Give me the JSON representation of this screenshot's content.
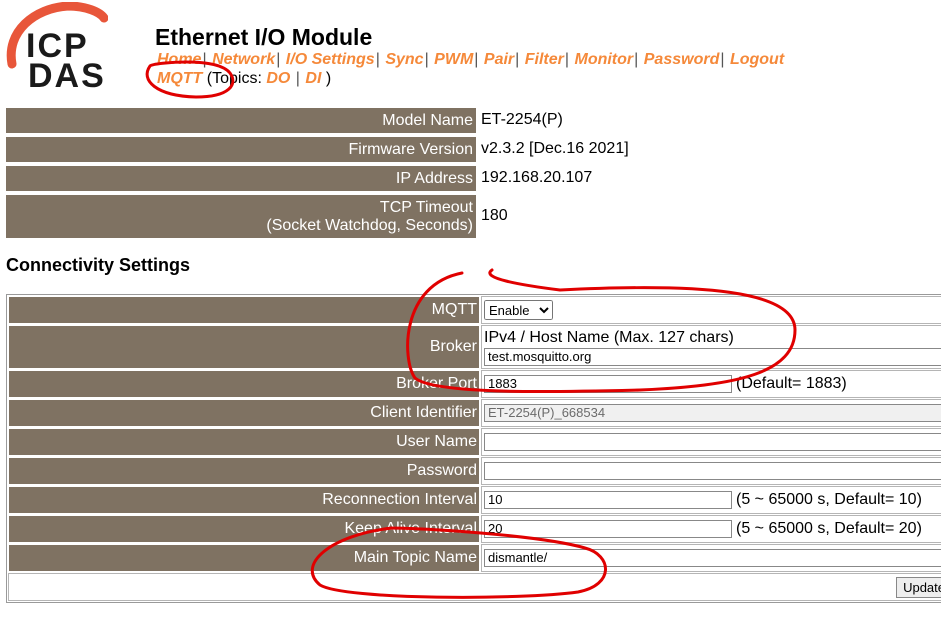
{
  "brand": {
    "logo_line1": "ICP",
    "logo_line2": "DAS",
    "accent": "#f5893a",
    "logo_arc": "#e8563a"
  },
  "header": {
    "title": "Ethernet I/O Module",
    "nav": [
      "Home",
      "Network",
      "I/O Settings",
      "Sync",
      "PWM",
      "Pair",
      "Filter",
      "Monitor",
      "Password",
      "Logout"
    ],
    "mqtt_link": "MQTT",
    "topics_prefix": "(Topics:",
    "topic_do": "DO",
    "topic_di": "DI",
    "topics_suffix": ")"
  },
  "info": {
    "model_label": "Model Name",
    "model_value": "ET-2254(P)",
    "fw_label": "Firmware Version",
    "fw_value": "v2.3.2 [Dec.16 2021]",
    "ip_label": "IP Address",
    "ip_value": "192.168.20.107",
    "tcp_label_1": "TCP Timeout",
    "tcp_label_2": "(Socket Watchdog, Seconds)",
    "tcp_value": "180"
  },
  "connectivity": {
    "section_title": "Connectivity Settings",
    "mqtt_label": "MQTT",
    "mqtt_value": "Enable",
    "broker_label": "Broker",
    "broker_hint": "IPv4 / Host Name (Max. 127 chars)",
    "broker_value": "test.mosquitto.org",
    "port_label": "Broker Port",
    "port_value": "1883",
    "port_note": "(Default= 1883)",
    "client_label": "Client Identifier",
    "client_value": "ET-2254(P)_668534",
    "user_label": "User Name",
    "user_value": "",
    "pass_label": "Password",
    "pass_value": "",
    "reconn_label": "Reconnection Interval",
    "reconn_value": "10",
    "reconn_note": "(5 ~ 65000 s, Default= 10)",
    "keep_label": "Keep Alive Interval",
    "keep_value": "20",
    "keep_note": "(5 ~ 65000 s, Default= 20)",
    "topic_label": "Main Topic Name",
    "topic_value": "dismantle/",
    "update_label": "Update"
  },
  "colors": {
    "label_bg": "#7f7262",
    "annotation_red": "#e00000"
  }
}
